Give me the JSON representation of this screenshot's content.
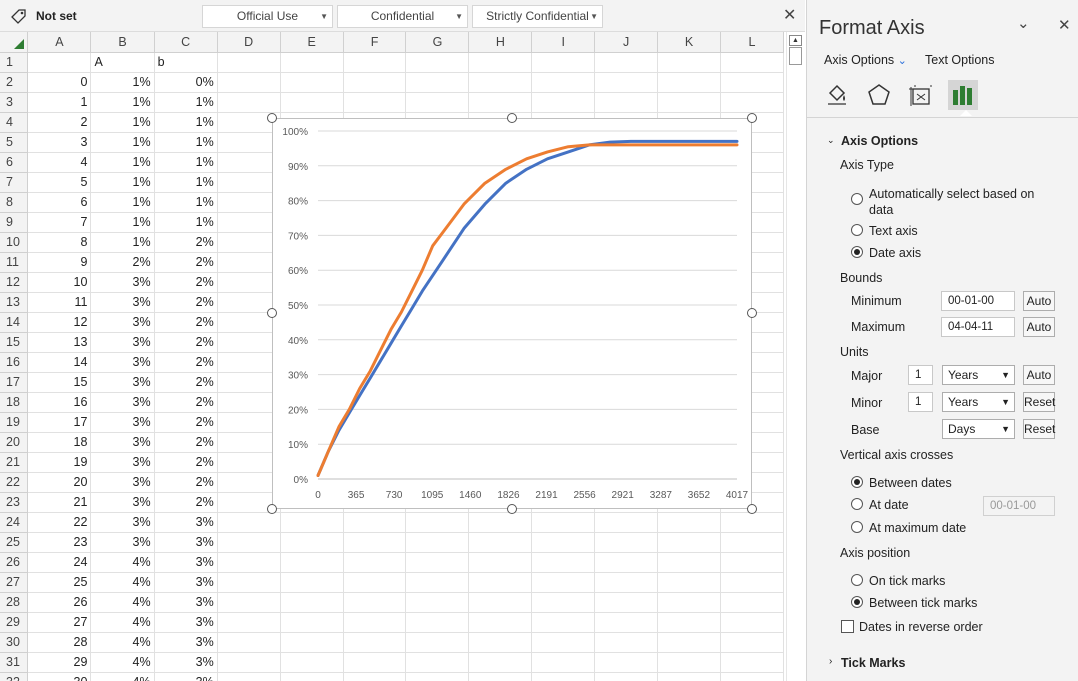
{
  "sensitivity": {
    "label": "Not set",
    "options": [
      "Official Use",
      "Confidential",
      "Strictly Confidential"
    ]
  },
  "sheet": {
    "columns": [
      "A",
      "B",
      "C",
      "D",
      "E",
      "F",
      "G",
      "H",
      "I",
      "J",
      "K",
      "L"
    ],
    "header_row": [
      "",
      "A",
      "b"
    ],
    "rows": [
      [
        "0",
        "1%",
        "0%"
      ],
      [
        "1",
        "1%",
        "1%"
      ],
      [
        "2",
        "1%",
        "1%"
      ],
      [
        "3",
        "1%",
        "1%"
      ],
      [
        "4",
        "1%",
        "1%"
      ],
      [
        "5",
        "1%",
        "1%"
      ],
      [
        "6",
        "1%",
        "1%"
      ],
      [
        "7",
        "1%",
        "1%"
      ],
      [
        "8",
        "1%",
        "2%"
      ],
      [
        "9",
        "2%",
        "2%"
      ],
      [
        "10",
        "3%",
        "2%"
      ],
      [
        "11",
        "3%",
        "2%"
      ],
      [
        "12",
        "3%",
        "2%"
      ],
      [
        "13",
        "3%",
        "2%"
      ],
      [
        "14",
        "3%",
        "2%"
      ],
      [
        "15",
        "3%",
        "2%"
      ],
      [
        "16",
        "3%",
        "2%"
      ],
      [
        "17",
        "3%",
        "2%"
      ],
      [
        "18",
        "3%",
        "2%"
      ],
      [
        "19",
        "3%",
        "2%"
      ],
      [
        "20",
        "3%",
        "2%"
      ],
      [
        "21",
        "3%",
        "2%"
      ],
      [
        "22",
        "3%",
        "3%"
      ],
      [
        "23",
        "3%",
        "3%"
      ],
      [
        "24",
        "4%",
        "3%"
      ],
      [
        "25",
        "4%",
        "3%"
      ],
      [
        "26",
        "4%",
        "3%"
      ],
      [
        "27",
        "4%",
        "3%"
      ],
      [
        "28",
        "4%",
        "3%"
      ],
      [
        "29",
        "4%",
        "3%"
      ],
      [
        "30",
        "4%",
        "3%"
      ]
    ]
  },
  "chart_data": {
    "type": "line",
    "x_ticks": [
      "0",
      "365",
      "730",
      "1095",
      "1460",
      "1826",
      "2191",
      "2556",
      "2921",
      "3287",
      "3652",
      "4017"
    ],
    "y_ticks": [
      "0%",
      "10%",
      "20%",
      "30%",
      "40%",
      "50%",
      "60%",
      "70%",
      "80%",
      "90%",
      "100%"
    ],
    "xlim": [
      0,
      4017
    ],
    "ylim": [
      0,
      100
    ],
    "grid": true,
    "series": [
      {
        "color": "#4472C4",
        "x": [
          0,
          100,
          200,
          300,
          400,
          500,
          600,
          700,
          800,
          900,
          1000,
          1200,
          1400,
          1600,
          1800,
          2000,
          2200,
          2400,
          2600,
          2800,
          3000,
          3500,
          4017
        ],
        "y": [
          1,
          8,
          14,
          19,
          24,
          29,
          34,
          39,
          44,
          49,
          54,
          63,
          72,
          79,
          85,
          89,
          92,
          94,
          96,
          96.8,
          97,
          97,
          97
        ]
      },
      {
        "color": "#ED7D31",
        "x": [
          0,
          100,
          200,
          300,
          400,
          500,
          600,
          700,
          800,
          900,
          1000,
          1100,
          1200,
          1300,
          1400,
          1500,
          1600,
          1800,
          2000,
          2200,
          2400,
          2600,
          2800,
          3000,
          3500,
          4017
        ],
        "y": [
          1,
          8,
          15,
          20,
          26,
          31,
          37,
          43,
          48,
          54,
          60,
          67,
          71,
          75,
          79,
          82,
          85,
          89,
          92,
          94,
          95.5,
          96,
          96,
          96,
          96,
          96
        ]
      }
    ]
  },
  "panel": {
    "title": "Format Axis",
    "tabs": {
      "axis_options": "Axis Options",
      "text_options": "Text Options"
    },
    "icons": [
      "fill-line-icon",
      "effects-icon",
      "size-properties-icon",
      "axis-options-icon"
    ],
    "section_axis": "Axis Options",
    "axis_type": {
      "label": "Axis Type",
      "opt_auto": "Automatically select based on",
      "opt_auto2": "data",
      "opt_text": "Text axis",
      "opt_date": "Date axis"
    },
    "bounds": {
      "label": "Bounds",
      "min_label": "Minimum",
      "min_value": "00-01-00",
      "max_label": "Maximum",
      "max_value": "04-04-11",
      "auto": "Auto"
    },
    "units": {
      "label": "Units",
      "major_label": "Major",
      "major_value": "1",
      "major_unit": "Years",
      "minor_label": "Minor",
      "minor_value": "1",
      "minor_unit": "Years",
      "base_label": "Base",
      "base_unit": "Days",
      "auto": "Auto",
      "reset": "Reset"
    },
    "crosses": {
      "label": "Vertical axis crosses",
      "between": "Between dates",
      "at_date": "At date",
      "at_date_value": "00-01-00",
      "at_max": "At maximum date"
    },
    "position": {
      "label": "Axis position",
      "on": "On tick marks",
      "between": "Between tick marks"
    },
    "reverse": "Dates in reverse order",
    "section_tick": "Tick Marks"
  }
}
